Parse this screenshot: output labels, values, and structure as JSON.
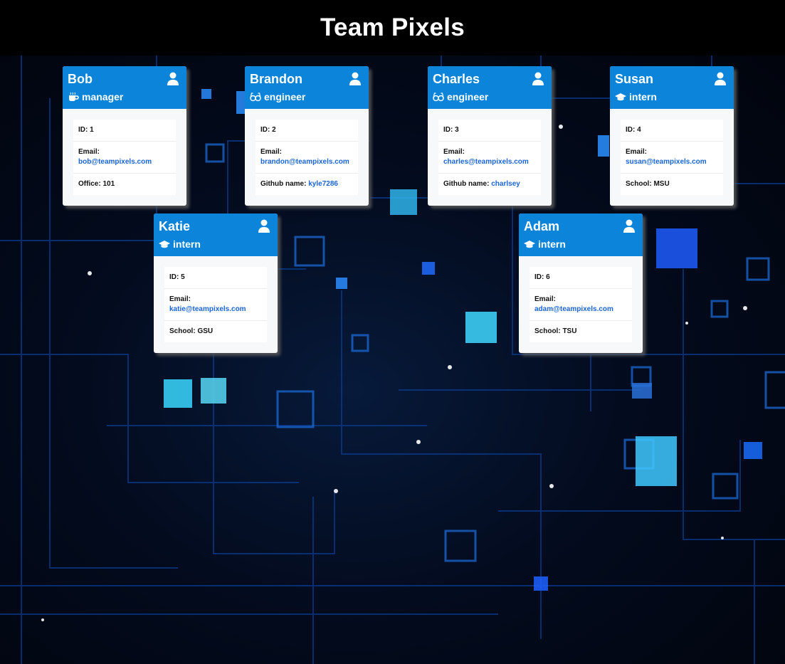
{
  "header": {
    "title": "Team Pixels"
  },
  "labels": {
    "id": "ID:",
    "email": "Email:",
    "office": "Office:",
    "github": "Github name:",
    "school": "School:"
  },
  "colors": {
    "card_header": "#0b84d9",
    "link": "#1a64d6",
    "background": "#000000"
  },
  "employees": [
    {
      "name": "Bob",
      "role": "manager",
      "role_icon": "coffee-icon",
      "id": "1",
      "email": "bob@teampixels.com",
      "office": "101"
    },
    {
      "name": "Brandon",
      "role": "engineer",
      "role_icon": "glasses-icon",
      "id": "2",
      "email": "brandon@teampixels.com",
      "github": "kyle7286"
    },
    {
      "name": "Charles",
      "role": "engineer",
      "role_icon": "glasses-icon",
      "id": "3",
      "email": "charles@teampixels.com",
      "github": "charlsey"
    },
    {
      "name": "Susan",
      "role": "intern",
      "role_icon": "graduation-cap-icon",
      "id": "4",
      "email": "susan@teampixels.com",
      "school": "MSU"
    },
    {
      "name": "Katie",
      "role": "intern",
      "role_icon": "graduation-cap-icon",
      "id": "5",
      "email": "katie@teampixels.com",
      "school": "GSU"
    },
    {
      "name": "Adam",
      "role": "intern",
      "role_icon": "graduation-cap-icon",
      "id": "6",
      "email": "adam@teampixels.com",
      "school": "TSU"
    }
  ]
}
